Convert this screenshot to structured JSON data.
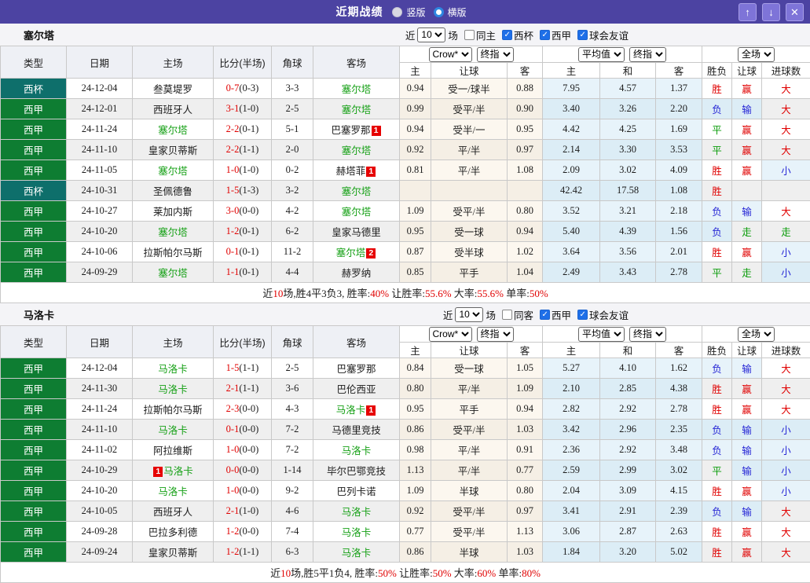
{
  "titlebar": {
    "title": "近期战绩",
    "radios": [
      {
        "label": "竖版",
        "selected": true
      },
      {
        "label": "横版",
        "selected": false
      }
    ],
    "icons": {
      "up": "↑",
      "down": "↓",
      "close": "✕"
    }
  },
  "colors": {
    "purple": "#4c43a2",
    "btn": "#7e74d8",
    "cup": "#0e6f6b",
    "lg": "#0e7d32",
    "team": "#15a015",
    "red": "#e00000",
    "blue": "#2525d5",
    "green": "#089b08",
    "cream": "#fcf7ef",
    "cream2": "#f5efe5",
    "lblue": "#e7f3fa",
    "lblue2": "#dcedf6"
  },
  "table_header": {
    "type": "类型",
    "date": "日期",
    "home": "主场",
    "score": "比分(半场)",
    "corner": "角球",
    "away": "客场",
    "dd_bookmaker": "Crow*",
    "dd_stage1": "终指",
    "dd_average": "平均值",
    "dd_stage2": "终指",
    "dd_scope": "全场",
    "sub": [
      "主",
      "让球",
      "客",
      "主",
      "和",
      "客",
      "胜负",
      "让球",
      "进球数"
    ]
  },
  "sections": [
    {
      "team": "塞尔塔",
      "recent": {
        "pre": "近",
        "value": "10",
        "post": "场"
      },
      "checks": [
        {
          "label": "同主",
          "checked": false
        },
        {
          "label": "西杯",
          "checked": true
        },
        {
          "label": "西甲",
          "checked": true
        },
        {
          "label": "球会友谊",
          "checked": true
        }
      ],
      "rows": [
        {
          "type": "西杯",
          "cup": true,
          "date": "24-12-04",
          "home": {
            "name": "叁莫堤罗"
          },
          "score": "0-7",
          "half": "(0-3)",
          "corner": "3-3",
          "away": {
            "name": "塞尔塔",
            "focus": true
          },
          "odds": [
            "0.94",
            "受一/球半",
            "0.88"
          ],
          "avg": [
            "7.95",
            "4.57",
            "1.37"
          ],
          "res": [
            "胜",
            "赢",
            "大"
          ]
        },
        {
          "type": "西甲",
          "cup": false,
          "date": "24-12-01",
          "home": {
            "name": "西班牙人"
          },
          "score": "3-1",
          "half": "(1-0)",
          "corner": "2-5",
          "away": {
            "name": "塞尔塔",
            "focus": true
          },
          "odds": [
            "0.99",
            "受平/半",
            "0.90"
          ],
          "avg": [
            "3.40",
            "3.26",
            "2.20"
          ],
          "res": [
            "负",
            "输",
            "大"
          ]
        },
        {
          "type": "西甲",
          "cup": false,
          "date": "24-11-24",
          "home": {
            "name": "塞尔塔",
            "focus": true
          },
          "score": "2-2",
          "half": "(0-1)",
          "corner": "5-1",
          "away": {
            "name": "巴塞罗那",
            "badge": "1"
          },
          "odds": [
            "0.94",
            "受半/一",
            "0.95"
          ],
          "avg": [
            "4.42",
            "4.25",
            "1.69"
          ],
          "res": [
            "平",
            "赢",
            "大"
          ]
        },
        {
          "type": "西甲",
          "cup": false,
          "date": "24-11-10",
          "home": {
            "name": "皇家贝蒂斯"
          },
          "score": "2-2",
          "half": "(1-1)",
          "corner": "2-0",
          "away": {
            "name": "塞尔塔",
            "focus": true
          },
          "odds": [
            "0.92",
            "平/半",
            "0.97"
          ],
          "avg": [
            "2.14",
            "3.30",
            "3.53"
          ],
          "res": [
            "平",
            "赢",
            "大"
          ]
        },
        {
          "type": "西甲",
          "cup": false,
          "date": "24-11-05",
          "home": {
            "name": "塞尔塔",
            "focus": true
          },
          "score": "1-0",
          "half": "(1-0)",
          "corner": "0-2",
          "away": {
            "name": "赫塔菲",
            "badge": "1"
          },
          "odds": [
            "0.81",
            "平/半",
            "1.08"
          ],
          "avg": [
            "2.09",
            "3.02",
            "4.09"
          ],
          "res": [
            "胜",
            "赢",
            "小"
          ]
        },
        {
          "type": "西杯",
          "cup": true,
          "date": "24-10-31",
          "home": {
            "name": "圣佩德鲁"
          },
          "score": "1-5",
          "half": "(1-3)",
          "corner": "3-2",
          "away": {
            "name": "塞尔塔",
            "focus": true
          },
          "odds": [
            "",
            "",
            ""
          ],
          "avg": [
            "42.42",
            "17.58",
            "1.08"
          ],
          "res": [
            "胜",
            "",
            ""
          ]
        },
        {
          "type": "西甲",
          "cup": false,
          "date": "24-10-27",
          "home": {
            "name": "莱加内斯"
          },
          "score": "3-0",
          "half": "(0-0)",
          "corner": "4-2",
          "away": {
            "name": "塞尔塔",
            "focus": true
          },
          "odds": [
            "1.09",
            "受平/半",
            "0.80"
          ],
          "avg": [
            "3.52",
            "3.21",
            "2.18"
          ],
          "res": [
            "负",
            "输",
            "大"
          ]
        },
        {
          "type": "西甲",
          "cup": false,
          "date": "24-10-20",
          "home": {
            "name": "塞尔塔",
            "focus": true
          },
          "score": "1-2",
          "half": "(0-1)",
          "corner": "6-2",
          "away": {
            "name": "皇家马德里"
          },
          "odds": [
            "0.95",
            "受一球",
            "0.94"
          ],
          "avg": [
            "5.40",
            "4.39",
            "1.56"
          ],
          "res": [
            "负",
            "走",
            "走"
          ]
        },
        {
          "type": "西甲",
          "cup": false,
          "date": "24-10-06",
          "home": {
            "name": "拉斯帕尔马斯"
          },
          "score": "0-1",
          "half": "(0-1)",
          "corner": "11-2",
          "away": {
            "name": "塞尔塔",
            "focus": true,
            "badge": "2"
          },
          "odds": [
            "0.87",
            "受半球",
            "1.02"
          ],
          "avg": [
            "3.64",
            "3.56",
            "2.01"
          ],
          "res": [
            "胜",
            "赢",
            "小"
          ]
        },
        {
          "type": "西甲",
          "cup": false,
          "date": "24-09-29",
          "home": {
            "name": "塞尔塔",
            "focus": true
          },
          "score": "1-1",
          "half": "(0-1)",
          "corner": "4-4",
          "away": {
            "name": "赫罗纳"
          },
          "odds": [
            "0.85",
            "平手",
            "1.04"
          ],
          "avg": [
            "2.49",
            "3.43",
            "2.78"
          ],
          "res": [
            "平",
            "走",
            "小"
          ]
        }
      ],
      "summary": [
        [
          "近",
          "d"
        ],
        [
          "10",
          "r"
        ],
        [
          "场,胜4平3负3, 胜率:",
          "d"
        ],
        [
          "40%",
          "r"
        ],
        [
          " 让胜率:",
          "d"
        ],
        [
          "55.6%",
          "r"
        ],
        [
          " 大率:",
          "d"
        ],
        [
          "55.6%",
          "r"
        ],
        [
          " 单率:",
          "d"
        ],
        [
          "50%",
          "r"
        ]
      ]
    },
    {
      "team": "马洛卡",
      "recent": {
        "pre": "近",
        "value": "10",
        "post": "场"
      },
      "checks": [
        {
          "label": "同客",
          "checked": false
        },
        {
          "label": "西甲",
          "checked": true
        },
        {
          "label": "球会友谊",
          "checked": true
        }
      ],
      "rows": [
        {
          "type": "西甲",
          "cup": false,
          "date": "24-12-04",
          "home": {
            "name": "马洛卡",
            "focus": true
          },
          "score": "1-5",
          "half": "(1-1)",
          "corner": "2-5",
          "away": {
            "name": "巴塞罗那"
          },
          "odds": [
            "0.84",
            "受一球",
            "1.05"
          ],
          "avg": [
            "5.27",
            "4.10",
            "1.62"
          ],
          "res": [
            "负",
            "输",
            "大"
          ]
        },
        {
          "type": "西甲",
          "cup": false,
          "date": "24-11-30",
          "home": {
            "name": "马洛卡",
            "focus": true
          },
          "score": "2-1",
          "half": "(1-1)",
          "corner": "3-6",
          "away": {
            "name": "巴伦西亚"
          },
          "odds": [
            "0.80",
            "平/半",
            "1.09"
          ],
          "avg": [
            "2.10",
            "2.85",
            "4.38"
          ],
          "res": [
            "胜",
            "赢",
            "大"
          ]
        },
        {
          "type": "西甲",
          "cup": false,
          "date": "24-11-24",
          "home": {
            "name": "拉斯帕尔马斯"
          },
          "score": "2-3",
          "half": "(0-0)",
          "corner": "4-3",
          "away": {
            "name": "马洛卡",
            "focus": true,
            "badge": "1"
          },
          "odds": [
            "0.95",
            "平手",
            "0.94"
          ],
          "avg": [
            "2.82",
            "2.92",
            "2.78"
          ],
          "res": [
            "胜",
            "赢",
            "大"
          ]
        },
        {
          "type": "西甲",
          "cup": false,
          "date": "24-11-10",
          "home": {
            "name": "马洛卡",
            "focus": true
          },
          "score": "0-1",
          "half": "(0-0)",
          "corner": "7-2",
          "away": {
            "name": "马德里竞技"
          },
          "odds": [
            "0.86",
            "受平/半",
            "1.03"
          ],
          "avg": [
            "3.42",
            "2.96",
            "2.35"
          ],
          "res": [
            "负",
            "输",
            "小"
          ]
        },
        {
          "type": "西甲",
          "cup": false,
          "date": "24-11-02",
          "home": {
            "name": "阿拉维斯"
          },
          "score": "1-0",
          "half": "(0-0)",
          "corner": "7-2",
          "away": {
            "name": "马洛卡",
            "focus": true
          },
          "odds": [
            "0.98",
            "平/半",
            "0.91"
          ],
          "avg": [
            "2.36",
            "2.92",
            "3.48"
          ],
          "res": [
            "负",
            "输",
            "小"
          ]
        },
        {
          "type": "西甲",
          "cup": false,
          "date": "24-10-29",
          "home": {
            "name": "马洛卡",
            "focus": true,
            "badge": "1",
            "badge_pos": "before"
          },
          "score": "0-0",
          "half": "(0-0)",
          "corner": "1-14",
          "away": {
            "name": "毕尔巴鄂竞技"
          },
          "odds": [
            "1.13",
            "平/半",
            "0.77"
          ],
          "avg": [
            "2.59",
            "2.99",
            "3.02"
          ],
          "res": [
            "平",
            "输",
            "小"
          ]
        },
        {
          "type": "西甲",
          "cup": false,
          "date": "24-10-20",
          "home": {
            "name": "马洛卡",
            "focus": true
          },
          "score": "1-0",
          "half": "(0-0)",
          "corner": "9-2",
          "away": {
            "name": "巴列卡诺"
          },
          "odds": [
            "1.09",
            "半球",
            "0.80"
          ],
          "avg": [
            "2.04",
            "3.09",
            "4.15"
          ],
          "res": [
            "胜",
            "赢",
            "小"
          ]
        },
        {
          "type": "西甲",
          "cup": false,
          "date": "24-10-05",
          "home": {
            "name": "西班牙人"
          },
          "score": "2-1",
          "half": "(1-0)",
          "corner": "4-6",
          "away": {
            "name": "马洛卡",
            "focus": true
          },
          "odds": [
            "0.92",
            "受平/半",
            "0.97"
          ],
          "avg": [
            "3.41",
            "2.91",
            "2.39"
          ],
          "res": [
            "负",
            "输",
            "大"
          ]
        },
        {
          "type": "西甲",
          "cup": false,
          "date": "24-09-28",
          "home": {
            "name": "巴拉多利德"
          },
          "score": "1-2",
          "half": "(0-0)",
          "corner": "7-4",
          "away": {
            "name": "马洛卡",
            "focus": true
          },
          "odds": [
            "0.77",
            "受平/半",
            "1.13"
          ],
          "avg": [
            "3.06",
            "2.87",
            "2.63"
          ],
          "res": [
            "胜",
            "赢",
            "大"
          ]
        },
        {
          "type": "西甲",
          "cup": false,
          "date": "24-09-24",
          "home": {
            "name": "皇家贝蒂斯"
          },
          "score": "1-2",
          "half": "(1-1)",
          "corner": "6-3",
          "away": {
            "name": "马洛卡",
            "focus": true
          },
          "odds": [
            "0.86",
            "半球",
            "1.03"
          ],
          "avg": [
            "1.84",
            "3.20",
            "5.02"
          ],
          "res": [
            "胜",
            "赢",
            "大"
          ]
        }
      ],
      "summary": [
        [
          "近",
          "d"
        ],
        [
          "10",
          "r"
        ],
        [
          "场,胜5平1负4, 胜率:",
          "d"
        ],
        [
          "50%",
          "r"
        ],
        [
          " 让胜率:",
          "d"
        ],
        [
          "50%",
          "r"
        ],
        [
          " 大率:",
          "d"
        ],
        [
          "60%",
          "r"
        ],
        [
          " 单率:",
          "d"
        ],
        [
          "80%",
          "r"
        ]
      ]
    }
  ]
}
